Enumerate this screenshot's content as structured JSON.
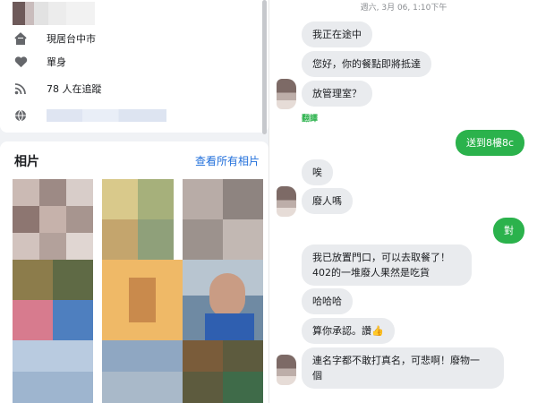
{
  "profile": {
    "intro": {
      "location": "現居台中市",
      "relationship": "單身",
      "followers": "78 人在追蹤",
      "icons": {
        "location": "house-icon",
        "relationship": "heart-icon",
        "followers": "rss-icon",
        "website": "globe-icon"
      }
    },
    "photos": {
      "title": "相片",
      "see_all": "查看所有相片"
    }
  },
  "chat": {
    "date": "週六, 3月 06, 1:10下午",
    "translate_label": "翻譯",
    "messages": [
      {
        "side": "in",
        "text": "我正在途中"
      },
      {
        "side": "in",
        "text": "您好，你的餐點即將抵達"
      },
      {
        "side": "in",
        "text": "放管理室？"
      },
      {
        "side": "out",
        "text": "送到8樓8c"
      },
      {
        "side": "in",
        "text": "唉"
      },
      {
        "side": "in",
        "text": "廢人嗎"
      },
      {
        "side": "out",
        "text": "對"
      },
      {
        "side": "in",
        "text": "我已放置門口，可以去取餐了！"
      },
      {
        "side": "in",
        "text": "402的一堆廢人果然是吃貨"
      },
      {
        "side": "in",
        "text": "哈哈哈"
      },
      {
        "side": "in",
        "text": "算你承認。讚"
      },
      {
        "side": "in",
        "text": "連名字都不敢打真名，可悲啊！廢物一"
      },
      {
        "side": "in",
        "text": "個"
      }
    ],
    "like_emoji": "👍",
    "colors": {
      "outgoing": "#2bb24c",
      "incoming": "#e9ebee",
      "link": "#216fdb"
    }
  }
}
